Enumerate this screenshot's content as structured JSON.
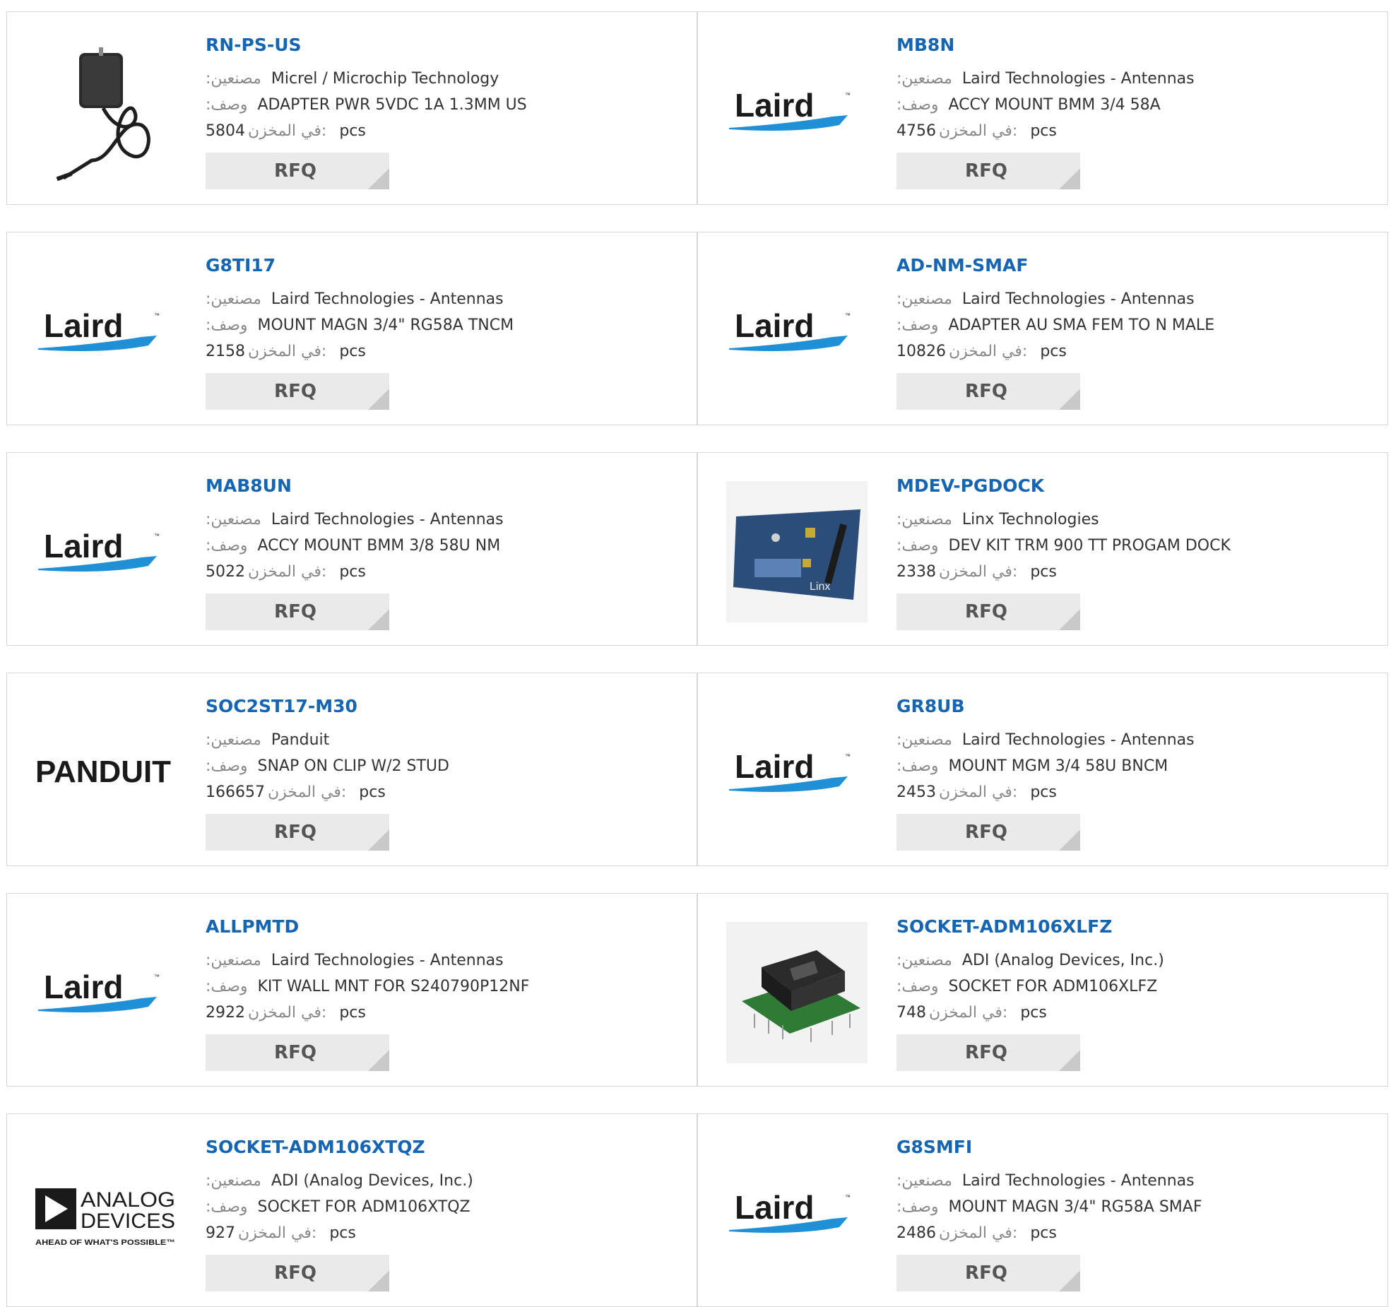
{
  "labels": {
    "manufacturer": ":مصنعين",
    "description": ":وصف",
    "stock": "في المخزن:",
    "unit": "pcs",
    "rfq": "RFQ"
  },
  "colors": {
    "title": "#1565b3",
    "laird": "#1a1a1a",
    "laird_swoosh": "#1f8fd6",
    "rfq_bg": "#eaeaea"
  },
  "products": [
    {
      "part": "RN-PS-US",
      "manufacturer": "Micrel / Microchip Technology",
      "description": "ADAPTER PWR 5VDC 1A 1.3MM US",
      "stock": "5804",
      "image": "power-adapter"
    },
    {
      "part": "MB8N",
      "manufacturer": "Laird Technologies - Antennas",
      "description": "ACCY MOUNT BMM 3/4 58A",
      "stock": "4756",
      "image": "laird-logo"
    },
    {
      "part": "G8TI17",
      "manufacturer": "Laird Technologies - Antennas",
      "description": "MOUNT MAGN 3/4\" RG58A TNCM",
      "stock": "2158",
      "image": "laird-logo"
    },
    {
      "part": "AD-NM-SMAF",
      "manufacturer": "Laird Technologies - Antennas",
      "description": "ADAPTER AU SMA FEM TO N MALE",
      "stock": "10826",
      "image": "laird-logo"
    },
    {
      "part": "MAB8UN",
      "manufacturer": "Laird Technologies - Antennas",
      "description": "ACCY MOUNT BMM 3/8 58U NM",
      "stock": "5022",
      "image": "laird-logo"
    },
    {
      "part": "MDEV-PGDOCK",
      "manufacturer": "Linx Technologies",
      "description": "DEV KIT TRM 900 TT PROGAM DOCK",
      "stock": "2338",
      "image": "dev-board"
    },
    {
      "part": "SOC2ST17-M30",
      "manufacturer": "Panduit",
      "description": "SNAP ON CLIP W/2 STUD",
      "stock": "166657",
      "image": "panduit-logo"
    },
    {
      "part": "GR8UB",
      "manufacturer": "Laird Technologies - Antennas",
      "description": "MOUNT MGM 3/4 58U BNCM",
      "stock": "2453",
      "image": "laird-logo"
    },
    {
      "part": "ALLPMTD",
      "manufacturer": "Laird Technologies - Antennas",
      "description": "KIT WALL MNT FOR S240790P12NF",
      "stock": "2922",
      "image": "laird-logo"
    },
    {
      "part": "SOCKET-ADM106XLFZ",
      "manufacturer": "ADI (Analog Devices, Inc.)",
      "description": "SOCKET FOR ADM106XLFZ",
      "stock": "748",
      "image": "socket-board"
    },
    {
      "part": "SOCKET-ADM106XTQZ",
      "manufacturer": "ADI (Analog Devices, Inc.)",
      "description": "SOCKET FOR ADM106XTQZ",
      "stock": "927",
      "image": "analog-devices-logo"
    },
    {
      "part": "G8SMFI",
      "manufacturer": "Laird Technologies - Antennas",
      "description": "MOUNT MAGN 3/4\" RG58A SMAF",
      "stock": "2486",
      "image": "laird-logo"
    }
  ],
  "logos": {
    "laird": "Laird",
    "panduit": "PANDUIT",
    "analog_devices_1": "ANALOG",
    "analog_devices_2": "DEVICES",
    "analog_devices_tagline": "AHEAD OF WHAT'S POSSIBLE™",
    "linx": "Linx"
  }
}
